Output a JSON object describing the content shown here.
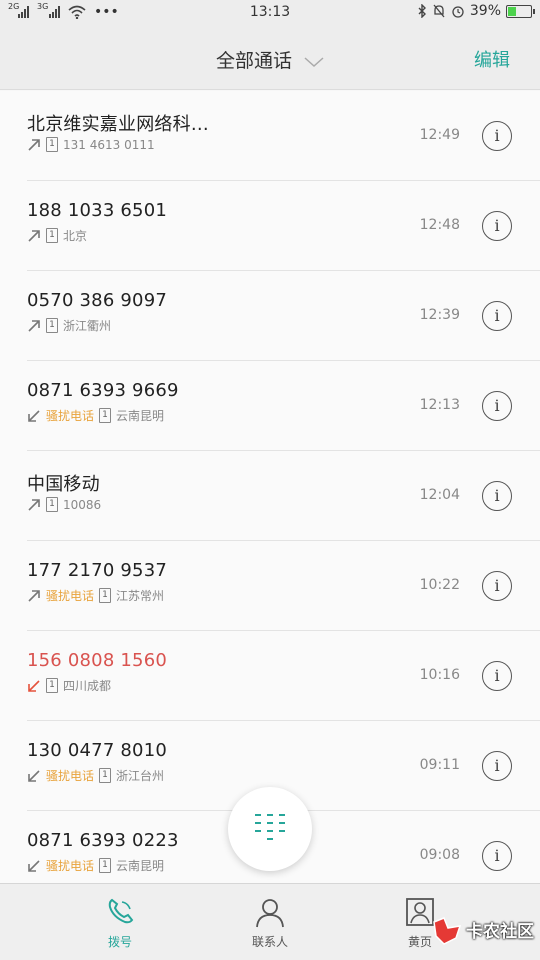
{
  "status_bar": {
    "network_left": "2G",
    "network_right": "3G",
    "time": "13:13",
    "battery": "39%",
    "battery_level": 0.39
  },
  "header": {
    "title": "全部通话",
    "edit": "编辑"
  },
  "calls": [
    {
      "name": "北京维实嘉业网络科…",
      "detail": "131 4613 0111",
      "time": "12:49",
      "direction": "outgoing",
      "spam": "",
      "missed": false
    },
    {
      "name": "188 1033 6501",
      "detail": "北京",
      "time": "12:48",
      "direction": "outgoing",
      "spam": "",
      "missed": false
    },
    {
      "name": "0570 386 9097",
      "detail": "浙江衢州",
      "time": "12:39",
      "direction": "outgoing",
      "spam": "",
      "missed": false
    },
    {
      "name": "0871 6393 9669",
      "detail": "云南昆明",
      "time": "12:13",
      "direction": "incoming",
      "spam": "骚扰电话",
      "missed": false
    },
    {
      "name": "中国移动",
      "detail": "10086",
      "time": "12:04",
      "direction": "outgoing",
      "spam": "",
      "missed": false
    },
    {
      "name": "177 2170 9537",
      "detail": "江苏常州",
      "time": "10:22",
      "direction": "outgoing",
      "spam": "骚扰电话",
      "missed": false
    },
    {
      "name": "156 0808 1560",
      "detail": "四川成都",
      "time": "10:16",
      "direction": "missed",
      "spam": "",
      "missed": true
    },
    {
      "name": "130 0477 8010",
      "detail": "浙江台州",
      "time": "09:11",
      "direction": "incoming",
      "spam": "骚扰电话",
      "missed": false
    },
    {
      "name": "0871 6393 0223",
      "detail": "云南昆明",
      "time": "09:08",
      "direction": "incoming",
      "spam": "骚扰电话",
      "missed": false
    }
  ],
  "sim_label": "1",
  "info_glyph": "i",
  "bottom_nav": [
    {
      "label": "拨号",
      "icon": "phone-icon",
      "active": true
    },
    {
      "label": "联系人",
      "icon": "person-icon",
      "active": false
    },
    {
      "label": "黄页",
      "icon": "yellow-pages-icon",
      "active": false
    }
  ],
  "watermark": "卡农社区",
  "colors": {
    "accent": "#26a69a",
    "missed": "#d9534f",
    "spam": "#e8a33c",
    "missed_arrow": "#e5533d"
  }
}
